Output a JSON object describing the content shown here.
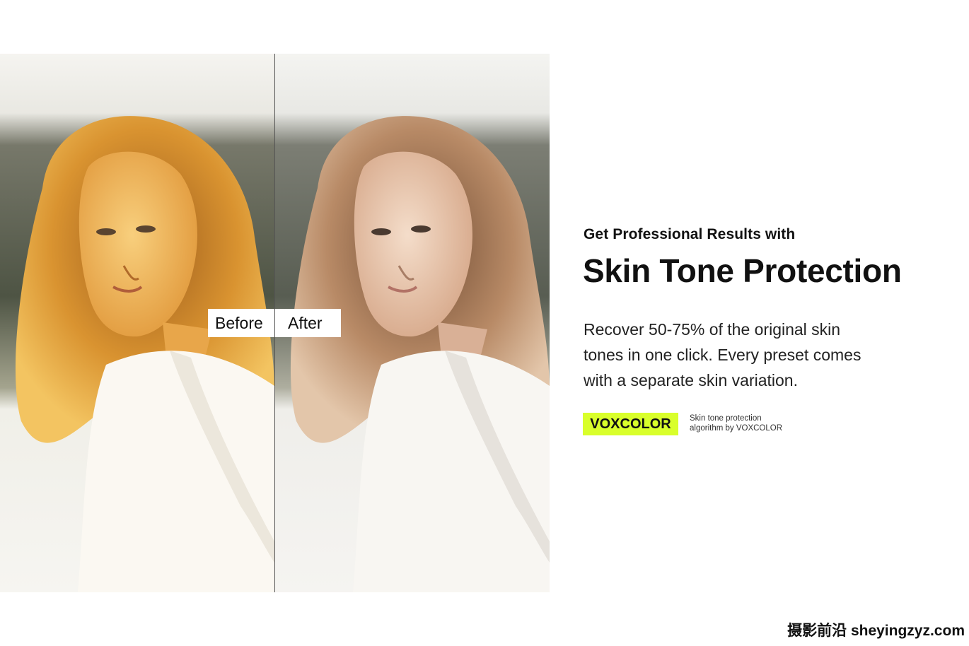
{
  "comparison": {
    "before_label": "Before",
    "after_label": "After"
  },
  "copy": {
    "kicker": "Get Professional Results with",
    "headline": "Skin Tone Protection",
    "body_lines": [
      "Recover 50-75% of the original skin",
      "tones in one click.  Every preset comes",
      "with a separate skin variation."
    ]
  },
  "badge": {
    "label": "VOXCOLOR",
    "note_lines": [
      "Skin tone protection",
      "algorithm by VOXCOLOR"
    ]
  },
  "watermark": "摄影前沿 sheyingzyz.com",
  "colors": {
    "badge_accent": "#d9ff2b",
    "before_tone": "#e8a63a",
    "after_tone": "#e9c7a9"
  }
}
